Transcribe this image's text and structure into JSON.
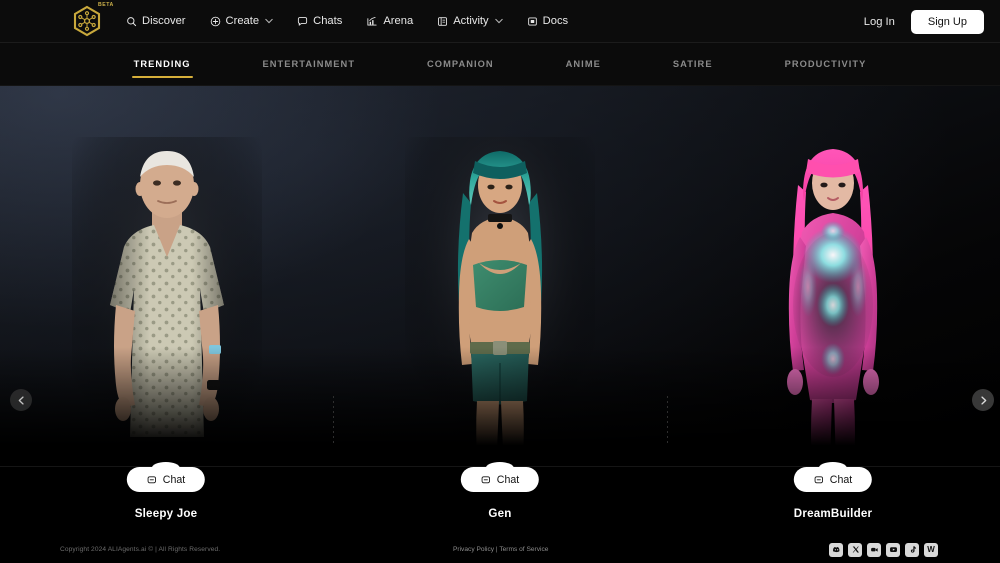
{
  "brand": {
    "logo_icon": "hexagon-network-logo",
    "badge": "BETA",
    "accent_gold": "#d6af3a"
  },
  "nav": {
    "items": [
      {
        "label": "Discover",
        "icon": "search-icon",
        "caret": false
      },
      {
        "label": "Create",
        "icon": "plus-circle-icon",
        "caret": true
      },
      {
        "label": "Chats",
        "icon": "chat-bubble-icon",
        "caret": false
      },
      {
        "label": "Arena",
        "icon": "bar-chart-icon",
        "caret": false
      },
      {
        "label": "Activity",
        "icon": "book-icon",
        "caret": true
      },
      {
        "label": "Docs",
        "icon": "document-icon",
        "caret": false
      }
    ],
    "login_label": "Log In",
    "signup_label": "Sign Up"
  },
  "tabs": {
    "active": "TRENDING",
    "items": [
      {
        "label": "TRENDING"
      },
      {
        "label": "ENTERTAINMENT"
      },
      {
        "label": "COMPANION"
      },
      {
        "label": "ANIME"
      },
      {
        "label": "SATIRE"
      },
      {
        "label": "PRODUCTIVITY"
      }
    ]
  },
  "carousel": {
    "prev_icon": "chevron-left-icon",
    "next_icon": "chevron-right-icon",
    "chat_label": "Chat",
    "chat_icon": "chat-bubble-icon",
    "cards": [
      {
        "name": "Sleepy Joe",
        "chat_label": "Chat"
      },
      {
        "name": "Gen",
        "chat_label": "Chat"
      },
      {
        "name": "DreamBuilder",
        "chat_label": "Chat"
      }
    ]
  },
  "footer": {
    "copyright": "Copyright 2024 ALIAgents.ai © | All Rights Reserved.",
    "privacy_label": "Privacy Policy",
    "separator": "|",
    "terms_label": "Terms of Service",
    "socials": [
      {
        "name": "discord-icon",
        "glyph": ""
      },
      {
        "name": "x-twitter-icon",
        "glyph": "X"
      },
      {
        "name": "video-icon",
        "glyph": ""
      },
      {
        "name": "youtube-icon",
        "glyph": ""
      },
      {
        "name": "tiktok-icon",
        "glyph": ""
      },
      {
        "name": "warpcast-icon",
        "glyph": "W"
      }
    ]
  }
}
